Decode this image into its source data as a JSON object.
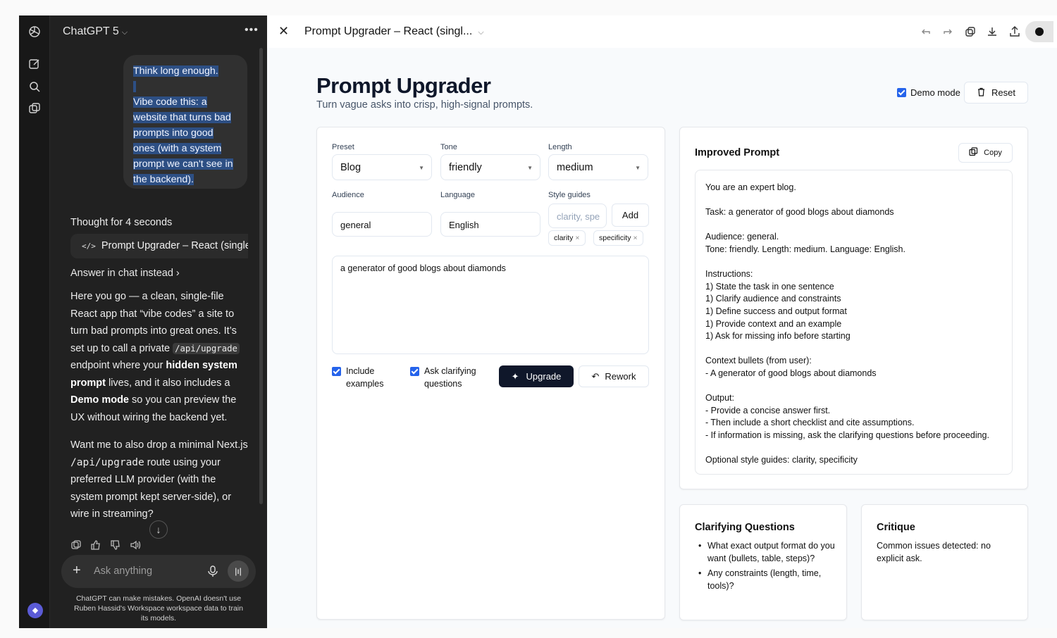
{
  "chat": {
    "model_name": "ChatGPT 5",
    "more_label": "•••",
    "user_message": {
      "line1": "Think long enough.",
      "lines": [
        "Vibe code this: a",
        "website that turns bad",
        "prompts into good",
        "ones (with a system",
        "prompt we can't see in",
        "the backend)."
      ]
    },
    "thought_label": "Thought for 4 seconds",
    "artifact_icon": "</>",
    "artifact_label": "Prompt Upgrader – React (single",
    "answer_in_chat": "Answer in chat instead",
    "reply": {
      "p1_a": "Here you go — a clean, single-file React app that “vibe codes” a site to turn bad prompts into great ones. It’s set up to call a private ",
      "p1_code": "/api/upgrade",
      "p1_b": " endpoint where your ",
      "p1_bold1": "hidden system prompt",
      "p1_c": " lives, and it also includes a ",
      "p1_bold2": "Demo mode",
      "p1_d": " so you can preview the UX without wiring the backend yet.",
      "p2_a": "Want me to also drop a minimal Next.js ",
      "p2_code": "/api/upgrade",
      "p2_b": " route using your preferred LLM provider (with the system prompt kept server-side), or wire in streaming?"
    },
    "composer_placeholder": "Ask anything",
    "disclaimer": "ChatGPT can make mistakes. OpenAI doesn't use Ruben Hassid's Workspace workspace data to train its models."
  },
  "doc": {
    "title": "Prompt Upgrader – React (singl...",
    "heading": "Prompt Upgrader",
    "subheading": "Turn vague asks into crisp, high-signal prompts.",
    "demo_mode_label": "Demo mode",
    "reset_label": "Reset",
    "form": {
      "preset_label": "Preset",
      "preset_value": "Blog",
      "tone_label": "Tone",
      "tone_value": "friendly",
      "length_label": "Length",
      "length_value": "medium",
      "audience_label": "Audience",
      "audience_value": "general",
      "language_label": "Language",
      "language_value": "English",
      "style_label": "Style guides",
      "style_placeholder": "clarity, spe",
      "add_label": "Add",
      "chips": [
        "clarity",
        "specificity"
      ],
      "textarea_value": "a generator of good blogs about diamonds",
      "include_examples": "Include examples",
      "ask_clarifying": "Ask clarifying questions",
      "upgrade_label": "Upgrade",
      "rework_label": "Rework"
    },
    "improved": {
      "title": "Improved Prompt",
      "copy_label": "Copy",
      "text": "You are an expert blog.\n\nTask: a generator of good blogs about diamonds\n\nAudience: general.\nTone: friendly. Length: medium. Language: English.\n\nInstructions:\n1) State the task in one sentence\n1) Clarify audience and constraints\n1) Define success and output format\n1) Provide context and an example\n1) Ask for missing info before starting\n\nContext bullets (from user):\n- A generator of good blogs about diamonds\n\nOutput:\n- Provide a concise answer first.\n- Then include a short checklist and cite assumptions.\n- If information is missing, ask the clarifying questions before proceeding.\n\nOptional style guides: clarity, specificity"
    },
    "clarifying": {
      "title": "Clarifying Questions",
      "items": [
        "What exact output format do you want (bullets, table, steps)?",
        "Any constraints (length, time, tools)?"
      ]
    },
    "critique": {
      "title": "Critique",
      "text": "Common issues detected: no explicit ask."
    }
  },
  "colors": {
    "sidebar_bg": "#212121",
    "rail_bg": "#181818",
    "accent": "#2563eb",
    "primary_btn": "#0f172a",
    "selection": "#2d4f84"
  }
}
